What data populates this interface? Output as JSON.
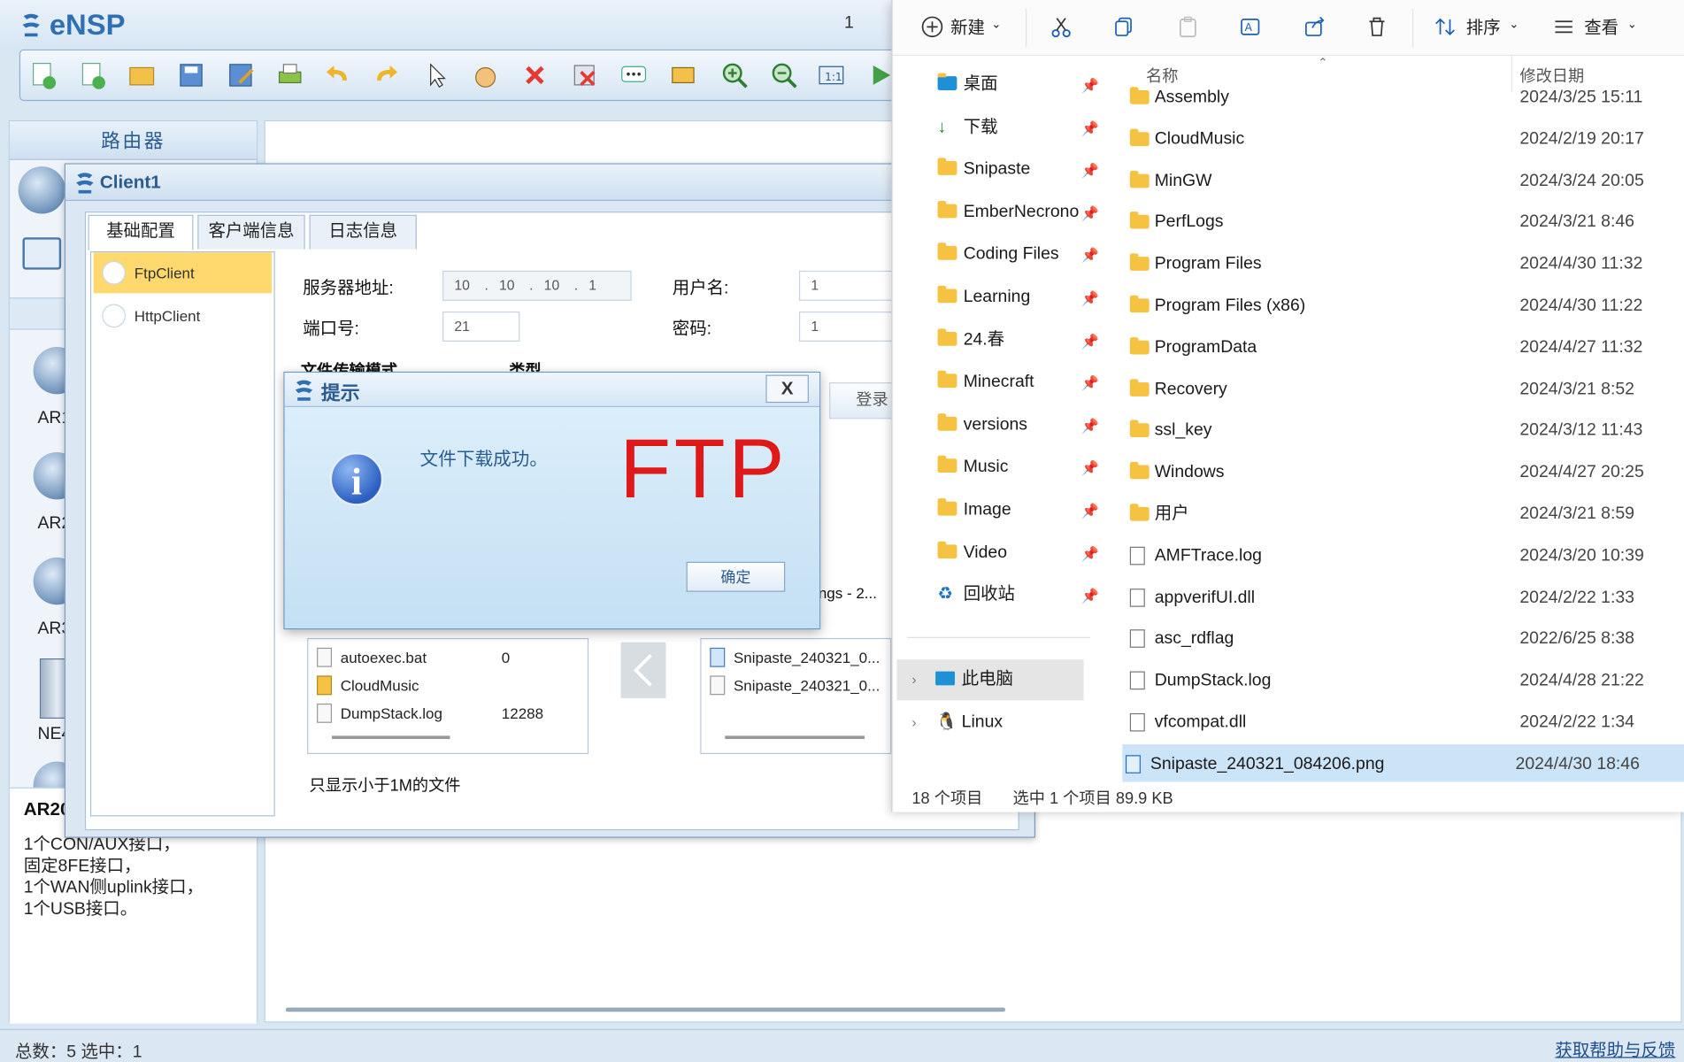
{
  "ensp": {
    "app_title": "eNSP",
    "version_fragment": "1",
    "category_header": "路由器",
    "devices": [
      "AR1",
      "AR2",
      "AR3",
      "NE4"
    ],
    "selected_device_info": {
      "name": "AR20",
      "lines": [
        "1个CON/AUX接口，",
        "固定8FE接口，",
        "1个WAN侧uplink接口，",
        "1个USB接口。"
      ]
    },
    "status": "总数：5  选中：1",
    "help_link": "获取帮助与反馈"
  },
  "client": {
    "title": "Client1",
    "tabs": [
      "基础配置",
      "客户端信息",
      "日志信息"
    ],
    "side_items": [
      "FtpClient",
      "HttpClient"
    ],
    "server_label": "服务器地址:",
    "server_ip": [
      "10",
      "10",
      "10",
      "1"
    ],
    "port_label": "端口号:",
    "port_value": "21",
    "user_label": "用户名:",
    "user_value": "1",
    "pass_label": "密码:",
    "pass_value": "1",
    "login_button": "登录",
    "group_label_a": "文件传输模式",
    "group_label_b": "类型",
    "remote_partial": "ngs - 2...",
    "local_files": [
      {
        "name": "autoexec.bat",
        "size": "0"
      },
      {
        "name": "CloudMusic",
        "size": ""
      },
      {
        "name": "DumpStack.log",
        "size": "12288"
      }
    ],
    "remote_files": [
      "Snipaste_240321_0...",
      "Snipaste_240321_0..."
    ],
    "footer_note": "只显示小于1M的文件"
  },
  "dialog": {
    "title": "提示",
    "close": "X",
    "message": "文件下载成功。",
    "overlay_text": "FTP",
    "ok_button": "确定"
  },
  "explorer": {
    "toolbar": {
      "new": "新建",
      "sort": "排序",
      "view": "查看"
    },
    "nav": [
      {
        "label": "桌面",
        "pinned": true
      },
      {
        "label": "下载",
        "pinned": true
      },
      {
        "label": "Snipaste",
        "pinned": true
      },
      {
        "label": "EmberNecrono",
        "pinned": true
      },
      {
        "label": "Coding Files",
        "pinned": true
      },
      {
        "label": "Learning",
        "pinned": true
      },
      {
        "label": "24.春",
        "pinned": true
      },
      {
        "label": "Minecraft",
        "pinned": true
      },
      {
        "label": "versions",
        "pinned": true
      },
      {
        "label": "Music",
        "pinned": true
      },
      {
        "label": "Image",
        "pinned": true
      },
      {
        "label": "Video",
        "pinned": true
      },
      {
        "label": "回收站",
        "pinned": true
      }
    ],
    "nav_tree": [
      "此电脑",
      "Linux"
    ],
    "columns": {
      "name": "名称",
      "date": "修改日期"
    },
    "files": [
      {
        "name": "Assembly",
        "date": "2024/3/25 15:11",
        "type": "folder"
      },
      {
        "name": "CloudMusic",
        "date": "2024/2/19 20:17",
        "type": "folder"
      },
      {
        "name": "MinGW",
        "date": "2024/3/24 20:05",
        "type": "folder"
      },
      {
        "name": "PerfLogs",
        "date": "2024/3/21 8:46",
        "type": "folder"
      },
      {
        "name": "Program Files",
        "date": "2024/4/30 11:32",
        "type": "folder"
      },
      {
        "name": "Program Files (x86)",
        "date": "2024/4/30 11:22",
        "type": "folder"
      },
      {
        "name": "ProgramData",
        "date": "2024/4/27 11:32",
        "type": "folder"
      },
      {
        "name": "Recovery",
        "date": "2024/3/21 8:52",
        "type": "folder"
      },
      {
        "name": "ssl_key",
        "date": "2024/3/12 11:43",
        "type": "folder"
      },
      {
        "name": "Windows",
        "date": "2024/4/27 20:25",
        "type": "folder"
      },
      {
        "name": "用户",
        "date": "2024/3/21 8:59",
        "type": "folder"
      },
      {
        "name": "AMFTrace.log",
        "date": "2024/3/20 10:39",
        "type": "file"
      },
      {
        "name": "appverifUI.dll",
        "date": "2024/2/22 1:33",
        "type": "file"
      },
      {
        "name": "asc_rdflag",
        "date": "2022/6/25 8:38",
        "type": "file"
      },
      {
        "name": "DumpStack.log",
        "date": "2024/4/28 21:22",
        "type": "file"
      },
      {
        "name": "vfcompat.dll",
        "date": "2024/2/22 1:34",
        "type": "file"
      },
      {
        "name": "Snipaste_240321_084206.png",
        "date": "2024/4/30 18:46",
        "type": "file",
        "selected": true
      }
    ],
    "status": {
      "count": "18 个项目",
      "selection": "选中 1 个项目  89.9 KB"
    }
  }
}
